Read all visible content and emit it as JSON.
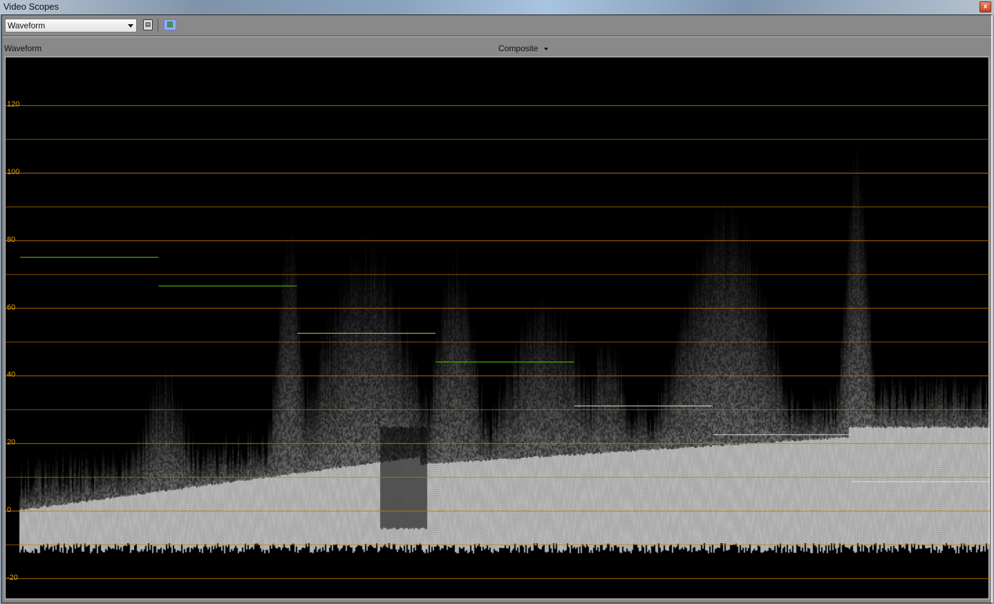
{
  "window": {
    "title": "Video Scopes",
    "close_label": "x"
  },
  "toolbar": {
    "scope_type": "Waveform"
  },
  "header": {
    "label": "Waveform",
    "mode": "Composite"
  },
  "chart_data": {
    "type": "waveform",
    "ylim": [
      -30,
      130
    ],
    "ticks": [
      120,
      100,
      80,
      60,
      40,
      20,
      0,
      -20
    ],
    "gridlines": [
      120,
      110,
      100,
      90,
      80,
      70,
      60,
      50,
      40,
      30,
      20,
      10,
      0,
      -10,
      -20
    ],
    "grid_color": "#c87800",
    "tick_color": "#e8a000",
    "reference_steps": [
      {
        "level": 75,
        "color": "#5fd400"
      },
      {
        "level": 66.5,
        "color": "#5fd400"
      },
      {
        "level": 52.5,
        "color": "#a8e070"
      },
      {
        "level": 44,
        "color": "#5fd400"
      },
      {
        "level": 31,
        "color": "#e0e0e0"
      },
      {
        "level": 22.5,
        "color": "#e0e0e0"
      },
      {
        "level": 8.6,
        "color": "#e0e0e0"
      }
    ]
  }
}
